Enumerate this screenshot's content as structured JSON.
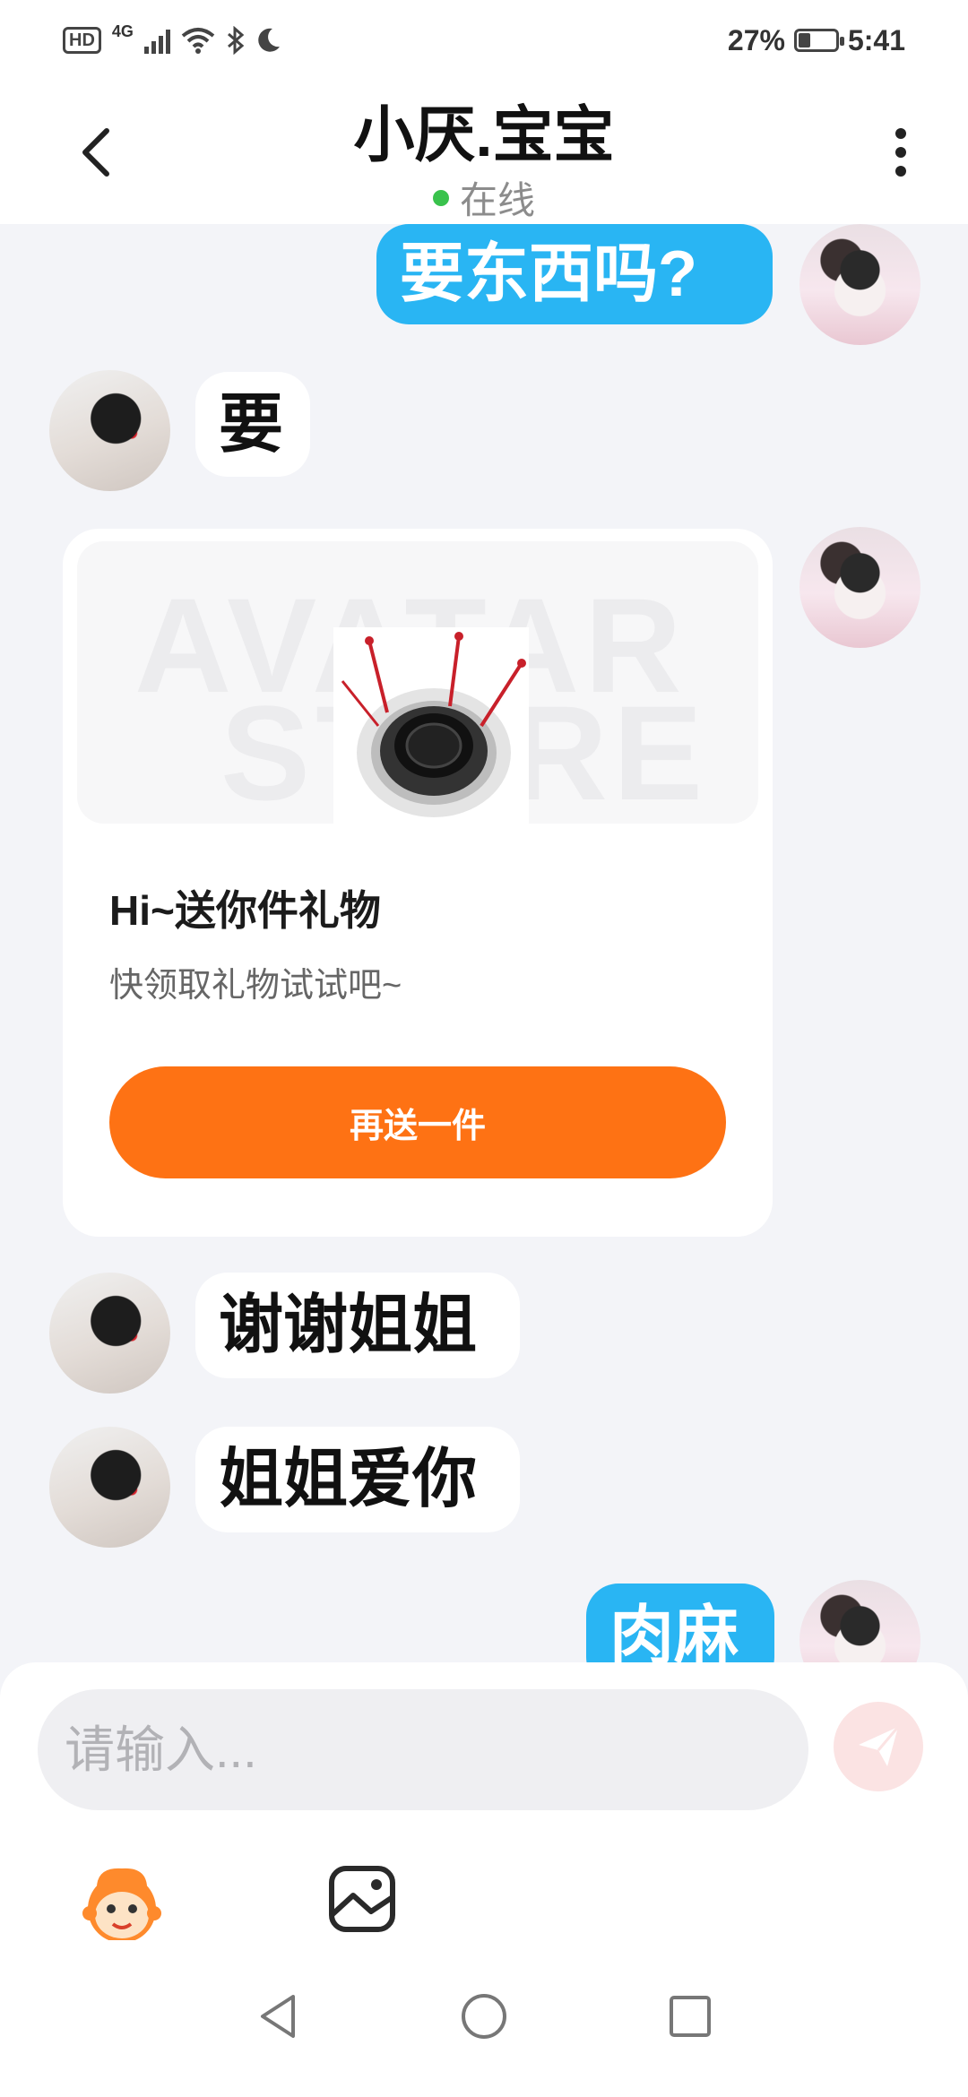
{
  "status_bar": {
    "hd": "HD",
    "network": "4G",
    "battery": "27%",
    "time": "5:41",
    "icons": [
      "signal-icon",
      "wifi-icon",
      "bluetooth-icon",
      "moon-icon",
      "battery-icon"
    ]
  },
  "header": {
    "title": "小厌.宝宝",
    "status": "在线",
    "status_color": "#39c24c"
  },
  "messages": [
    {
      "sender": "me",
      "text": "要东西吗?"
    },
    {
      "sender": "other",
      "text": "要"
    },
    {
      "sender": "me",
      "type": "gift",
      "watermark_1": "AVATAR",
      "watermark_2": "STORE",
      "title": "Hi~送你件礼物",
      "subtitle": "快领取礼物试试吧~",
      "button": "再送一件"
    },
    {
      "sender": "other",
      "text": "谢谢姐姐"
    },
    {
      "sender": "other",
      "text": "姐姐爱你"
    },
    {
      "sender": "me",
      "text": "肉麻"
    }
  ],
  "composer": {
    "placeholder": "请输入...",
    "send_icon": "send-icon",
    "tools": [
      "emoji-sticker-icon",
      "image-icon"
    ]
  },
  "nav": [
    "back-triangle-icon",
    "home-circle-icon",
    "recents-square-icon"
  ],
  "colors": {
    "my_bubble": "#29b5f3",
    "other_bubble": "#ffffff",
    "gift_button": "#fe7214",
    "background": "#f3f4f8"
  }
}
